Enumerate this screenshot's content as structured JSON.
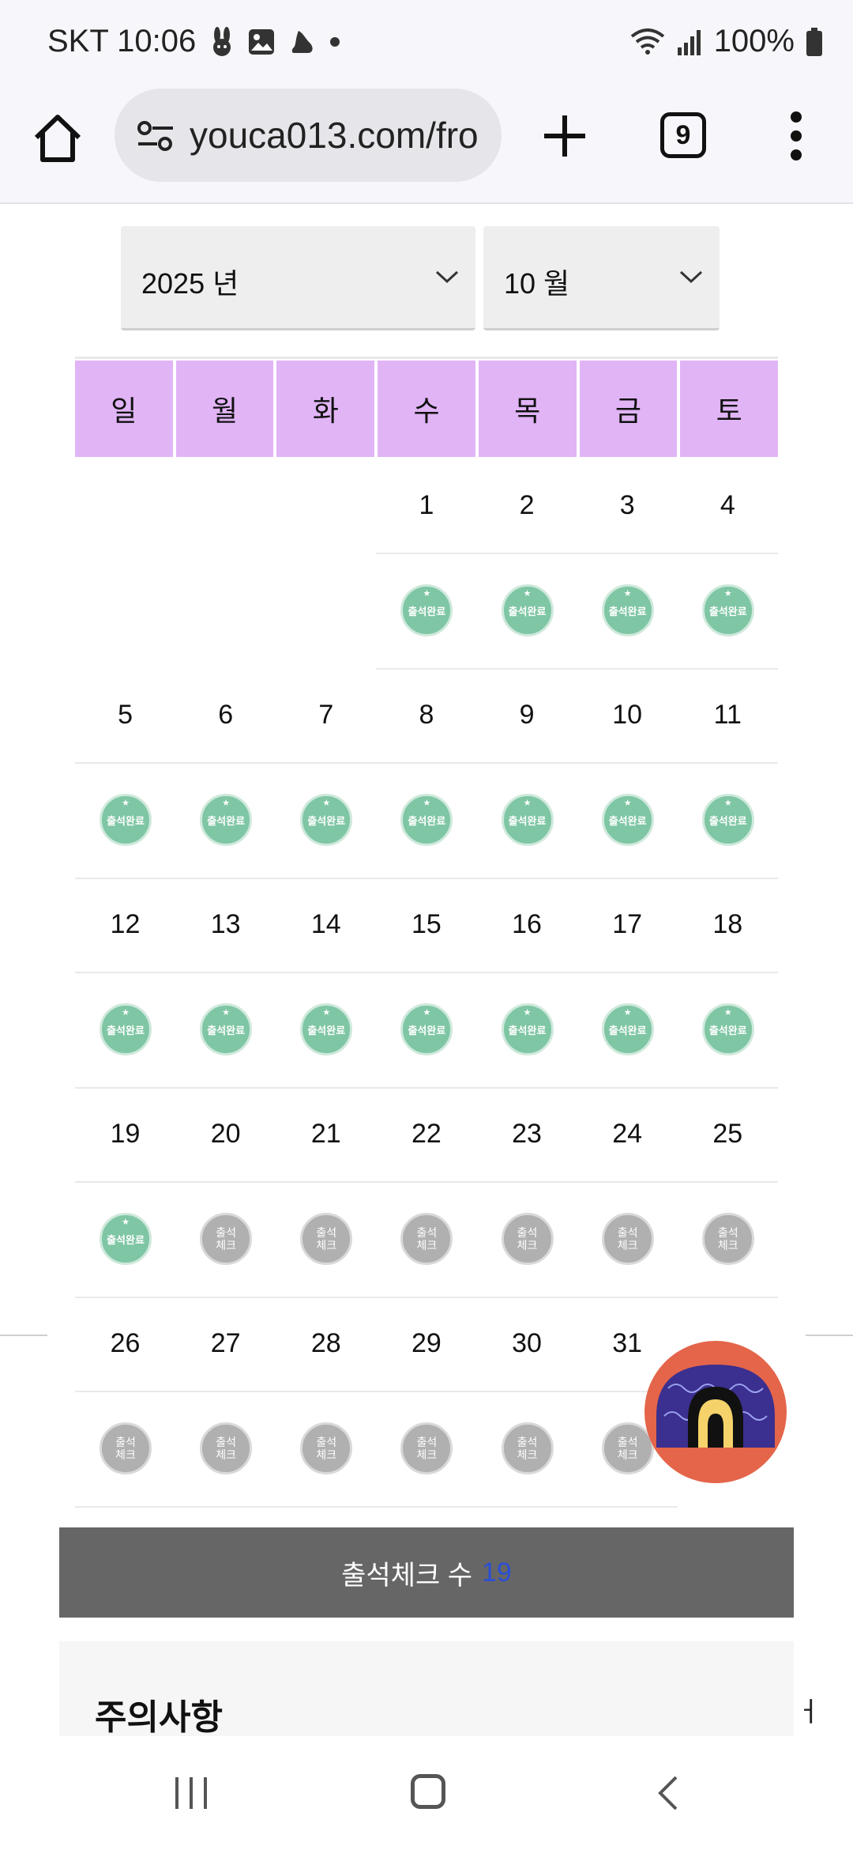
{
  "status_bar": {
    "carrier_time": "SKT 10:06",
    "battery": "100%",
    "icons": [
      "rabbit-icon",
      "image-icon",
      "shoe-icon",
      "dot-icon",
      "wifi-icon",
      "signal-icon",
      "battery-icon"
    ]
  },
  "browser": {
    "url": "youca013.com/fro",
    "tab_count": "9",
    "icons": [
      "home-icon",
      "tune-icon",
      "plus-icon",
      "tabs-icon",
      "more-icon"
    ]
  },
  "selects": {
    "year": "2025 년",
    "month": "10 월"
  },
  "calendar": {
    "weekdays": [
      "일",
      "월",
      "화",
      "수",
      "목",
      "금",
      "토"
    ],
    "stamp_done_label": "출석완료",
    "stamp_todo_label": "출석 체크",
    "weeks": [
      {
        "days": [
          "",
          "",
          "",
          "1",
          "2",
          "3",
          "4"
        ],
        "stamps": [
          "",
          "",
          "",
          "done",
          "done",
          "done",
          "done"
        ]
      },
      {
        "days": [
          "5",
          "6",
          "7",
          "8",
          "9",
          "10",
          "11"
        ],
        "stamps": [
          "done",
          "done",
          "done",
          "done",
          "done",
          "done",
          "done"
        ]
      },
      {
        "days": [
          "12",
          "13",
          "14",
          "15",
          "16",
          "17",
          "18"
        ],
        "stamps": [
          "done",
          "done",
          "done",
          "done",
          "done",
          "done",
          "done"
        ]
      },
      {
        "days": [
          "19",
          "20",
          "21",
          "22",
          "23",
          "24",
          "25"
        ],
        "stamps": [
          "done",
          "todo",
          "todo",
          "todo",
          "todo",
          "todo",
          "todo"
        ]
      },
      {
        "days": [
          "26",
          "27",
          "28",
          "29",
          "30",
          "31",
          ""
        ],
        "stamps": [
          "todo",
          "todo",
          "todo",
          "todo",
          "todo",
          "todo",
          ""
        ]
      }
    ]
  },
  "count_bar": {
    "label": "출석체크 수",
    "count": "19"
  },
  "notice": {
    "title": "주의사항",
    "side_char": "ㅓ"
  },
  "colors": {
    "weekday_header": "#e1b4f6",
    "stamp_done": "#7fc6a4",
    "stamp_todo": "#b0b0b0",
    "count_bar_bg": "#666666",
    "count_number": "#2b4fd6",
    "logo_bg": "#e4654a"
  }
}
